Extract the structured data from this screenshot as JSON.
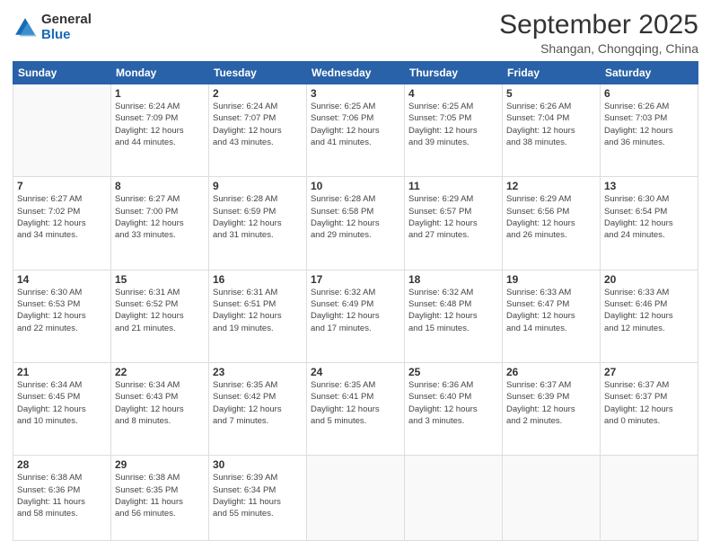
{
  "logo": {
    "general": "General",
    "blue": "Blue"
  },
  "header": {
    "title": "September 2025",
    "subtitle": "Shangan, Chongqing, China"
  },
  "days_header": [
    "Sunday",
    "Monday",
    "Tuesday",
    "Wednesday",
    "Thursday",
    "Friday",
    "Saturday"
  ],
  "weeks": [
    [
      {
        "num": "",
        "info": ""
      },
      {
        "num": "1",
        "info": "Sunrise: 6:24 AM\nSunset: 7:09 PM\nDaylight: 12 hours\nand 44 minutes."
      },
      {
        "num": "2",
        "info": "Sunrise: 6:24 AM\nSunset: 7:07 PM\nDaylight: 12 hours\nand 43 minutes."
      },
      {
        "num": "3",
        "info": "Sunrise: 6:25 AM\nSunset: 7:06 PM\nDaylight: 12 hours\nand 41 minutes."
      },
      {
        "num": "4",
        "info": "Sunrise: 6:25 AM\nSunset: 7:05 PM\nDaylight: 12 hours\nand 39 minutes."
      },
      {
        "num": "5",
        "info": "Sunrise: 6:26 AM\nSunset: 7:04 PM\nDaylight: 12 hours\nand 38 minutes."
      },
      {
        "num": "6",
        "info": "Sunrise: 6:26 AM\nSunset: 7:03 PM\nDaylight: 12 hours\nand 36 minutes."
      }
    ],
    [
      {
        "num": "7",
        "info": "Sunrise: 6:27 AM\nSunset: 7:02 PM\nDaylight: 12 hours\nand 34 minutes."
      },
      {
        "num": "8",
        "info": "Sunrise: 6:27 AM\nSunset: 7:00 PM\nDaylight: 12 hours\nand 33 minutes."
      },
      {
        "num": "9",
        "info": "Sunrise: 6:28 AM\nSunset: 6:59 PM\nDaylight: 12 hours\nand 31 minutes."
      },
      {
        "num": "10",
        "info": "Sunrise: 6:28 AM\nSunset: 6:58 PM\nDaylight: 12 hours\nand 29 minutes."
      },
      {
        "num": "11",
        "info": "Sunrise: 6:29 AM\nSunset: 6:57 PM\nDaylight: 12 hours\nand 27 minutes."
      },
      {
        "num": "12",
        "info": "Sunrise: 6:29 AM\nSunset: 6:56 PM\nDaylight: 12 hours\nand 26 minutes."
      },
      {
        "num": "13",
        "info": "Sunrise: 6:30 AM\nSunset: 6:54 PM\nDaylight: 12 hours\nand 24 minutes."
      }
    ],
    [
      {
        "num": "14",
        "info": "Sunrise: 6:30 AM\nSunset: 6:53 PM\nDaylight: 12 hours\nand 22 minutes."
      },
      {
        "num": "15",
        "info": "Sunrise: 6:31 AM\nSunset: 6:52 PM\nDaylight: 12 hours\nand 21 minutes."
      },
      {
        "num": "16",
        "info": "Sunrise: 6:31 AM\nSunset: 6:51 PM\nDaylight: 12 hours\nand 19 minutes."
      },
      {
        "num": "17",
        "info": "Sunrise: 6:32 AM\nSunset: 6:49 PM\nDaylight: 12 hours\nand 17 minutes."
      },
      {
        "num": "18",
        "info": "Sunrise: 6:32 AM\nSunset: 6:48 PM\nDaylight: 12 hours\nand 15 minutes."
      },
      {
        "num": "19",
        "info": "Sunrise: 6:33 AM\nSunset: 6:47 PM\nDaylight: 12 hours\nand 14 minutes."
      },
      {
        "num": "20",
        "info": "Sunrise: 6:33 AM\nSunset: 6:46 PM\nDaylight: 12 hours\nand 12 minutes."
      }
    ],
    [
      {
        "num": "21",
        "info": "Sunrise: 6:34 AM\nSunset: 6:45 PM\nDaylight: 12 hours\nand 10 minutes."
      },
      {
        "num": "22",
        "info": "Sunrise: 6:34 AM\nSunset: 6:43 PM\nDaylight: 12 hours\nand 8 minutes."
      },
      {
        "num": "23",
        "info": "Sunrise: 6:35 AM\nSunset: 6:42 PM\nDaylight: 12 hours\nand 7 minutes."
      },
      {
        "num": "24",
        "info": "Sunrise: 6:35 AM\nSunset: 6:41 PM\nDaylight: 12 hours\nand 5 minutes."
      },
      {
        "num": "25",
        "info": "Sunrise: 6:36 AM\nSunset: 6:40 PM\nDaylight: 12 hours\nand 3 minutes."
      },
      {
        "num": "26",
        "info": "Sunrise: 6:37 AM\nSunset: 6:39 PM\nDaylight: 12 hours\nand 2 minutes."
      },
      {
        "num": "27",
        "info": "Sunrise: 6:37 AM\nSunset: 6:37 PM\nDaylight: 12 hours\nand 0 minutes."
      }
    ],
    [
      {
        "num": "28",
        "info": "Sunrise: 6:38 AM\nSunset: 6:36 PM\nDaylight: 11 hours\nand 58 minutes."
      },
      {
        "num": "29",
        "info": "Sunrise: 6:38 AM\nSunset: 6:35 PM\nDaylight: 11 hours\nand 56 minutes."
      },
      {
        "num": "30",
        "info": "Sunrise: 6:39 AM\nSunset: 6:34 PM\nDaylight: 11 hours\nand 55 minutes."
      },
      {
        "num": "",
        "info": ""
      },
      {
        "num": "",
        "info": ""
      },
      {
        "num": "",
        "info": ""
      },
      {
        "num": "",
        "info": ""
      }
    ]
  ]
}
